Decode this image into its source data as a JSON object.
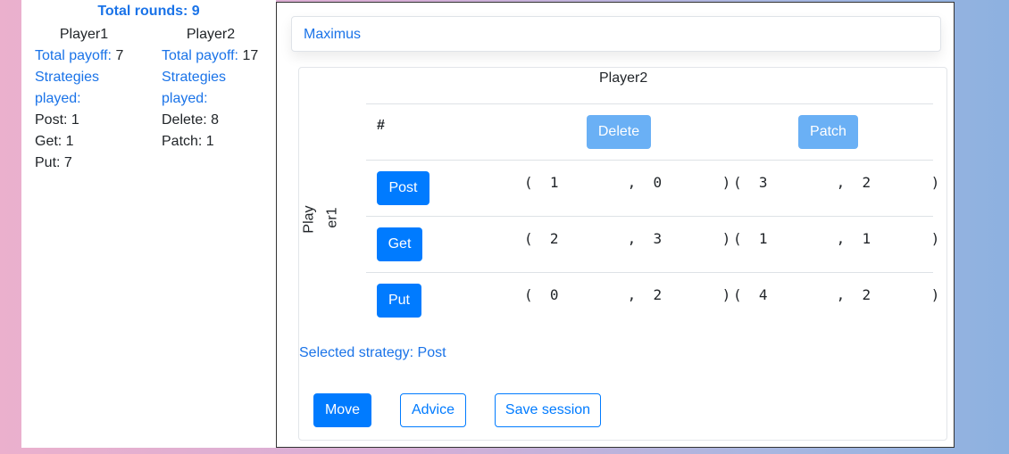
{
  "summary": {
    "total_rounds_label": "Total rounds: 9",
    "player1": {
      "name": "Player1",
      "payoff_label": "Total payoff:",
      "payoff_value": "7",
      "strategies_label_1": "Strategies",
      "strategies_label_2": "played:",
      "strategies": [
        "Post: 1",
        "Get: 1",
        "Put: 7"
      ]
    },
    "player2": {
      "name": "Player2",
      "payoff_label": "Total payoff:",
      "payoff_value": "17",
      "strategies_label_1": "Strategies",
      "strategies_label_2": "played:",
      "strategies": [
        "Delete: 8",
        "Patch: 1"
      ]
    }
  },
  "game": {
    "name": "Maximus",
    "column_player": "Player2",
    "row_player_part1": "Play",
    "row_player_part2": "er1",
    "corner_header": "#",
    "columns": [
      "Delete",
      "Patch"
    ],
    "rows": [
      {
        "label": "Post",
        "cells": [
          [
            "1",
            "0"
          ],
          [
            "3",
            "2"
          ]
        ]
      },
      {
        "label": "Get",
        "cells": [
          [
            "2",
            "3"
          ],
          [
            "1",
            "1"
          ]
        ]
      },
      {
        "label": "Put",
        "cells": [
          [
            "0",
            "2"
          ],
          [
            "4",
            "2"
          ]
        ]
      }
    ],
    "selected_strategy": "Selected strategy: Post"
  },
  "actions": {
    "move": "Move",
    "advice": "Advice",
    "save": "Save session"
  },
  "colors": {
    "primary": "#007bff",
    "primary_light": "#6ab0f5",
    "link_blue": "#1a73e8"
  }
}
